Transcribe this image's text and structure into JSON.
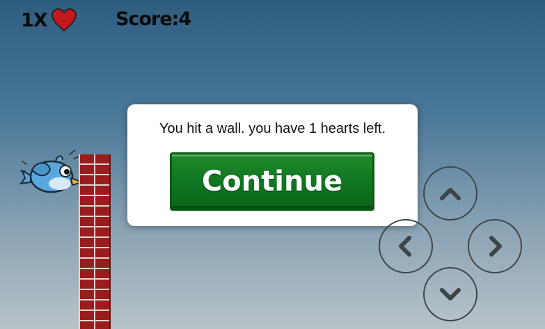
{
  "hud": {
    "lives_text": "1X",
    "score_text": "Score:4"
  },
  "dialog": {
    "message": "You hit a wall. you have 1 hearts left.",
    "continue_label": "Continue"
  },
  "controls": [
    "up-arrow-icon",
    "left-arrow-icon",
    "right-arrow-icon",
    "down-arrow-icon"
  ],
  "colors": {
    "sky_top": "#2f5d80",
    "sky_bottom": "#b8c3c8",
    "heart": "#c4161c",
    "brick": "#9b1c1c",
    "continue_button": "#0f7421"
  }
}
